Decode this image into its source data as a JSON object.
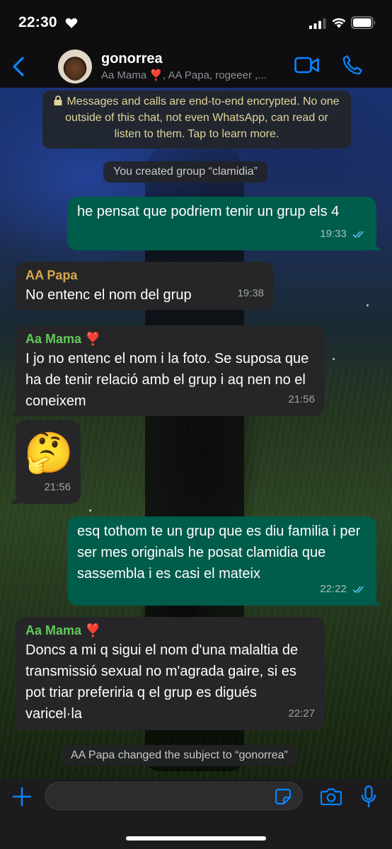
{
  "status_bar": {
    "time": "22:30"
  },
  "header": {
    "group_name": "gonorrea",
    "members": "Aa Mama ❣️, AA Papa, rogeeer ,..."
  },
  "encryption_notice": "Messages and calls are end-to-end encrypted. No one outside of this chat, not even WhatsApp, can read or listen to them. Tap to learn more.",
  "system_events": {
    "created": "You created group “clamidia”",
    "subject_changed": "AA Papa changed the subject to “gonorrea”"
  },
  "messages": [
    {
      "direction": "out",
      "text": "he pensat que podriem tenir un grup els 4",
      "time": "19:33"
    },
    {
      "direction": "in",
      "sender": "AA Papa",
      "text": "No entenc el nom del grup",
      "time": "19:38"
    },
    {
      "direction": "in",
      "sender": "Aa Mama ❣️",
      "text": "I jo no entenc el nom i la foto. Se suposa que ha de tenir relació amb el grup i aq nen no el coneixem",
      "time": "21:56"
    },
    {
      "direction": "in",
      "text": "🤔",
      "time": "21:56"
    },
    {
      "direction": "out",
      "text": "esq tothom te un grup que es diu familia i per ser mes originals he posat clamidia que sassembla i es casi el mateix",
      "time": "22:22"
    },
    {
      "direction": "in",
      "sender": "Aa Mama ❣️",
      "text": "Doncs a mi q sigui el nom d'una malaltia de transmissió sexual no m'agrada gaire, si es pot triar preferiria q el grup es digués varicel·la",
      "time": "22:27"
    }
  ],
  "input": {
    "value": "",
    "placeholder": ""
  },
  "colors": {
    "accent": "#0a84ff",
    "outgoing_bubble": "#005c4b",
    "incoming_bubble": "#262628",
    "sender_papa": "#d8a94a",
    "sender_mama": "#63c95a",
    "read_ticks": "#53bdeb"
  },
  "icons": [
    "heart-icon",
    "signal-icon",
    "wifi-icon",
    "battery-icon",
    "back-icon",
    "video-call-icon",
    "phone-call-icon",
    "lock-icon",
    "read-ticks-icon",
    "plus-icon",
    "sticker-icon",
    "camera-icon",
    "mic-icon"
  ]
}
